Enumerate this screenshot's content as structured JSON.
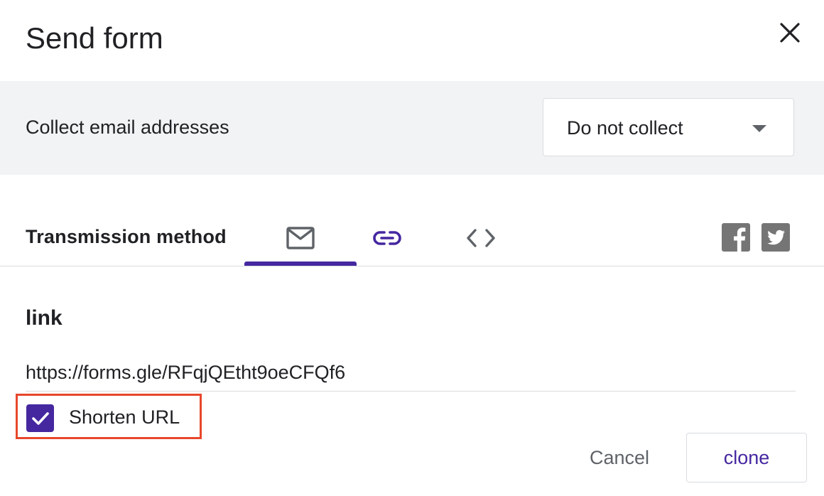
{
  "dialog": {
    "title": "Send form",
    "close_icon": "close-icon"
  },
  "collect_email": {
    "label": "Collect email addresses",
    "selected": "Do not collect"
  },
  "transmission": {
    "label": "Transmission method",
    "tabs": [
      {
        "icon": "email-icon",
        "selected": true
      },
      {
        "icon": "link-icon",
        "selected": false
      },
      {
        "icon": "embed-code-icon",
        "selected": false
      }
    ],
    "share_icons": [
      "facebook-icon",
      "twitter-icon"
    ]
  },
  "link_section": {
    "heading": "link",
    "url": "https://forms.gle/RFqjQEtht9oeCFQf6",
    "shorten_url_label": "Shorten URL",
    "shorten_url_checked": true
  },
  "actions": {
    "cancel_label": "Cancel",
    "clone_label": "clone"
  },
  "colors": {
    "accent": "#4527a0",
    "highlight": "#e8472b",
    "band_background": "#f1f3f4"
  }
}
